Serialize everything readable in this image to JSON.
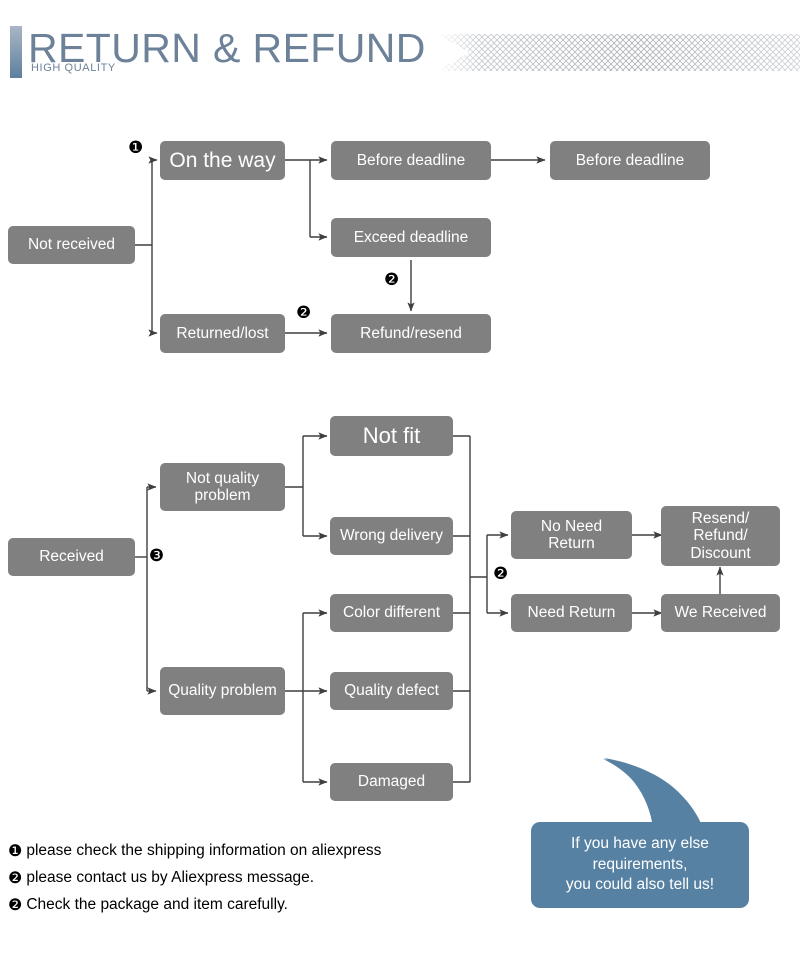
{
  "header": {
    "title": "RETURN & REFUND",
    "subtitle": "HIGH QUALITY",
    "accent_color": "#6d8299",
    "ribbon_pattern": "crosshatch"
  },
  "colors": {
    "box_fill": "#808080",
    "box_text": "#ffffff",
    "title": "#6d8299",
    "bubble": "#5681a3",
    "wire": "#3f3f3f"
  },
  "flow_not_received": {
    "root": "Not received",
    "marker_1": "❶",
    "boxes": {
      "on_the_way": "On the way",
      "before_deadline_1": "Before deadline",
      "before_deadline_2": "Before deadline",
      "exceed_deadline": "Exceed deadline",
      "returned_lost": "Returned/lost",
      "refund_resend": "Refund/resend"
    },
    "marker_exceed_to_refund": "❷",
    "marker_returned_to_refund": "❷"
  },
  "flow_received": {
    "root": "Received",
    "marker_3": "❸",
    "boxes": {
      "not_quality_problem": "Not quality\nproblem",
      "quality_problem": "Quality problem",
      "not_fit": "Not fit",
      "wrong_delivery": "Wrong delivery",
      "color_different": "Color different",
      "quality_defect": "Quality defect",
      "damaged": "Damaged",
      "no_need_return": "No Need\nReturn",
      "need_return": "Need Return",
      "we_received": "We Received",
      "resend_refund_discount": "Resend/\nRefund/\nDiscount"
    },
    "marker_return_split": "❷"
  },
  "footnotes": [
    {
      "num": "❶",
      "text": "please check the shipping information on aliexpress"
    },
    {
      "num": "❷",
      "text": "please contact us by Aliexpress message."
    },
    {
      "num": "❷",
      "text": "Check the package and item carefully."
    }
  ],
  "bubble": {
    "line1": "If you have any else",
    "line2": "requirements,",
    "line3": "you could also tell us!"
  }
}
